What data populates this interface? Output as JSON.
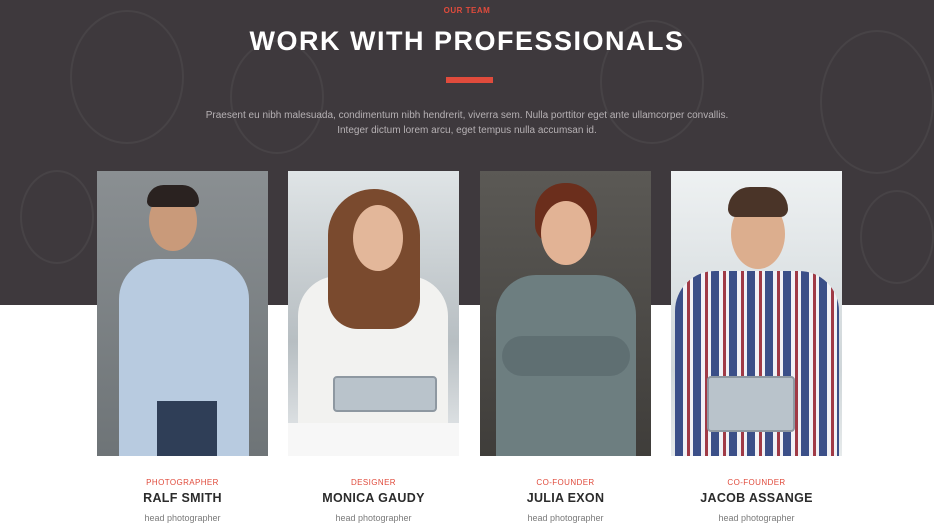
{
  "section": {
    "eyebrow": "OUR TEAM",
    "title": "WORK WITH PROFESSIONALS",
    "description_line1": "Praesent eu nibh malesuada, condimentum nibh hendrerit, viverra sem. Nulla porttitor eget ante ullamcorper convallis.",
    "description_line2": "Integer dictum lorem arcu, eget tempus nulla accumsan id."
  },
  "colors": {
    "accent": "#e04b3c",
    "hero_bg": "#3e393d",
    "text_dark": "#2b2b2b",
    "text_muted": "#7a7a7a"
  },
  "team": [
    {
      "role": "PHOTOGRAPHER",
      "name": "RALF SMITH",
      "subtitle": "head photographer"
    },
    {
      "role": "DESIGNER",
      "name": "MONICA GAUDY",
      "subtitle": "head photographer"
    },
    {
      "role": "CO-FOUNDER",
      "name": "JULIA EXON",
      "subtitle": "head photographer"
    },
    {
      "role": "CO-FOUNDER",
      "name": "JACOB ASSANGE",
      "subtitle": "head photographer"
    }
  ]
}
